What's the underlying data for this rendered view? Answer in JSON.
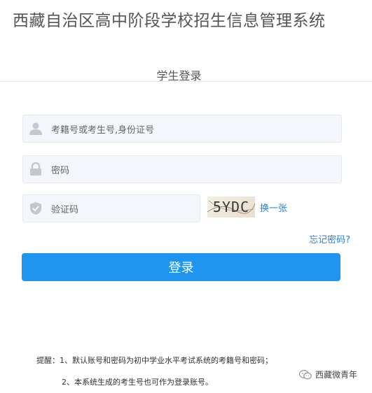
{
  "header": {
    "title": "西藏自治区高中阶段学校招生信息管理系统",
    "subtitle": "学生登录"
  },
  "form": {
    "username_placeholder": "考籍号或考生号,身份证号",
    "password_placeholder": "密码",
    "captcha_placeholder": "验证码",
    "captcha_text": "5YDC",
    "refresh_label": "换一张",
    "forgot_label": "忘记密码?",
    "login_label": "登录"
  },
  "tips": {
    "line1": "提醒：1、默认账号和密码为初中学业水平考试系统的考籍号和密码；",
    "line2": "2、本系统生成的考生号也可作为登录账号。"
  },
  "watermark": {
    "text": "西藏微青年"
  },
  "colors": {
    "accent": "#1e96f0",
    "link": "#2a7fd4",
    "input_bg": "#f3f6fb"
  }
}
